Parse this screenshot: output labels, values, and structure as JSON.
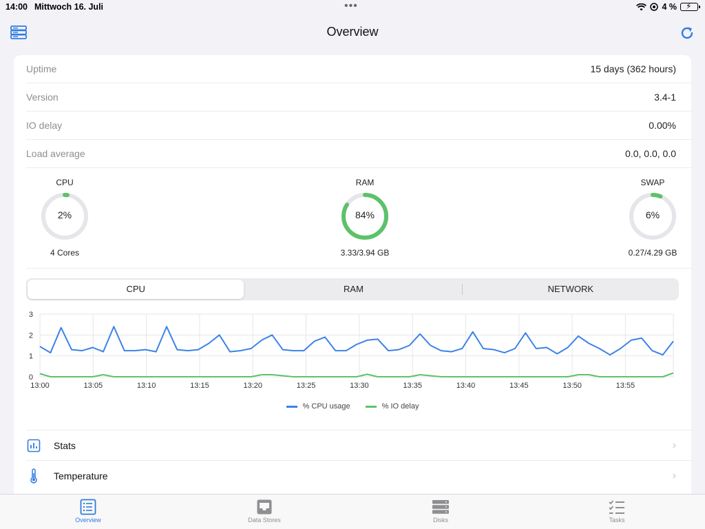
{
  "status_bar": {
    "time": "14:00",
    "date": "Mittwoch 16. Juli",
    "battery": "4 %"
  },
  "nav": {
    "title": "Overview"
  },
  "info": [
    {
      "label": "Uptime",
      "value": "15 days (362 hours)"
    },
    {
      "label": "Version",
      "value": "3.4-1"
    },
    {
      "label": "IO delay",
      "value": "0.00%"
    },
    {
      "label": "Load average",
      "value": "0.0, 0.0, 0.0"
    }
  ],
  "gauges": [
    {
      "title": "CPU",
      "percent_label": "2%",
      "fraction": 0.02,
      "sub": "4 Cores"
    },
    {
      "title": "RAM",
      "percent_label": "84%",
      "fraction": 0.84,
      "sub": "3.33/3.94 GB"
    },
    {
      "title": "SWAP",
      "percent_label": "6%",
      "fraction": 0.06,
      "sub": "0.27/4.29 GB"
    }
  ],
  "segments": [
    "CPU",
    "RAM",
    "NETWORK"
  ],
  "colors": {
    "accent": "#2f7be0",
    "cpu_line": "#3b82e6",
    "io_line": "#5cc26a",
    "ring_bg": "#e5e5ea",
    "ring_fg": "#5cc26a"
  },
  "chart_data": {
    "type": "line",
    "x": [
      "13:00",
      "13:05",
      "13:10",
      "13:15",
      "13:20",
      "13:25",
      "13:30",
      "13:35",
      "13:40",
      "13:45",
      "13:50",
      "13:55"
    ],
    "ylim": [
      0,
      3
    ],
    "yticks": [
      "0",
      "1",
      "2",
      "3"
    ],
    "series": [
      {
        "name": "% CPU usage",
        "values": [
          1.45,
          1.15,
          2.35,
          1.3,
          1.25,
          1.4,
          1.2,
          2.4,
          1.25,
          1.25,
          1.3,
          1.2,
          2.4,
          1.3,
          1.25,
          1.3,
          1.6,
          2.0,
          1.2,
          1.25,
          1.35,
          1.75,
          2.0,
          1.3,
          1.25,
          1.25,
          1.7,
          1.9,
          1.25,
          1.25,
          1.55,
          1.75,
          1.8,
          1.25,
          1.3,
          1.5,
          2.05,
          1.5,
          1.25,
          1.2,
          1.35,
          2.15,
          1.35,
          1.3,
          1.15,
          1.35,
          2.1,
          1.35,
          1.4,
          1.1,
          1.4,
          1.95,
          1.6,
          1.35,
          1.05,
          1.35,
          1.75,
          1.85,
          1.25,
          1.05,
          1.7
        ]
      },
      {
        "name": "% IO delay",
        "values": [
          0.15,
          0.0,
          0.0,
          0.0,
          0.0,
          0.0,
          0.1,
          0.0,
          0.0,
          0.0,
          0.0,
          0.0,
          0.0,
          0.0,
          0.0,
          0.0,
          0.0,
          0.0,
          0.0,
          0.0,
          0.0,
          0.1,
          0.1,
          0.05,
          0.0,
          0.0,
          0.0,
          0.0,
          0.0,
          0.0,
          0.0,
          0.12,
          0.0,
          0.0,
          0.0,
          0.0,
          0.1,
          0.05,
          0.0,
          0.0,
          0.0,
          0.0,
          0.0,
          0.0,
          0.0,
          0.0,
          0.0,
          0.0,
          0.0,
          0.0,
          0.0,
          0.1,
          0.1,
          0.0,
          0.0,
          0.0,
          0.0,
          0.0,
          0.0,
          0.0,
          0.18
        ]
      }
    ],
    "legend": "bottom-center"
  },
  "list": [
    {
      "label": "Stats",
      "icon": "stats-icon"
    },
    {
      "label": "Temperature",
      "icon": "thermometer-icon"
    }
  ],
  "tabs": [
    {
      "label": "Overview",
      "icon": "overview-icon",
      "active": true
    },
    {
      "label": "Data Stores",
      "icon": "data-stores-icon",
      "active": false
    },
    {
      "label": "Disks",
      "icon": "disks-icon",
      "active": false
    },
    {
      "label": "Tasks",
      "icon": "tasks-icon",
      "active": false
    }
  ]
}
